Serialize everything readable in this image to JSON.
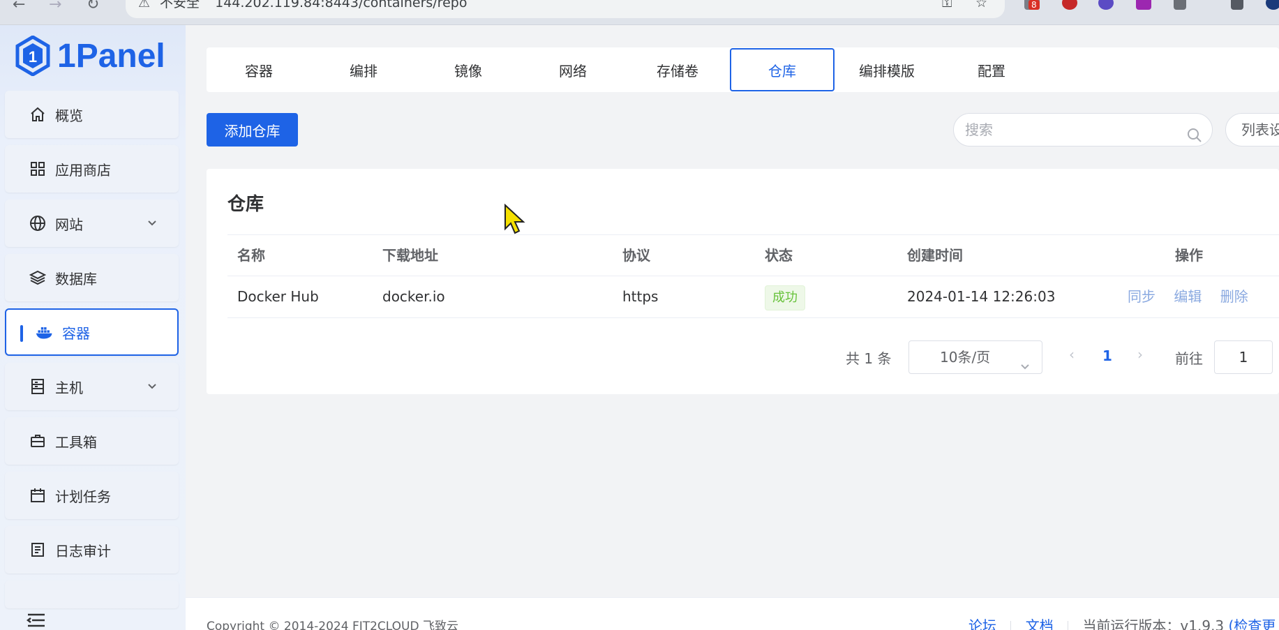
{
  "browser": {
    "security_label": "不安全",
    "url": "144.202.119.84:8443/containers/repo",
    "extension_badge": "8"
  },
  "sidebar": {
    "logo_text": "1Panel",
    "items": [
      {
        "label": "概览",
        "icon": "home-icon"
      },
      {
        "label": "应用商店",
        "icon": "grid-icon"
      },
      {
        "label": "网站",
        "icon": "globe-icon"
      },
      {
        "label": "数据库",
        "icon": "layers-icon"
      },
      {
        "label": "容器",
        "icon": "docker-icon"
      },
      {
        "label": "主机",
        "icon": "server-icon"
      },
      {
        "label": "工具箱",
        "icon": "toolbox-icon"
      },
      {
        "label": "计划任务",
        "icon": "calendar-icon"
      },
      {
        "label": "日志审计",
        "icon": "log-icon"
      }
    ]
  },
  "tabs": [
    {
      "label": "容器"
    },
    {
      "label": "编排"
    },
    {
      "label": "镜像"
    },
    {
      "label": "网络"
    },
    {
      "label": "存储卷"
    },
    {
      "label": "仓库",
      "active": true
    },
    {
      "label": "编排模版"
    },
    {
      "label": "配置"
    }
  ],
  "toolbar": {
    "add_label": "添加仓库",
    "search_placeholder": "搜索",
    "list_settings_label": "列表设"
  },
  "card": {
    "title": "仓库",
    "columns": [
      "名称",
      "下载地址",
      "协议",
      "状态",
      "创建时间",
      "操作"
    ],
    "rows": [
      {
        "name": "Docker Hub",
        "download_url": "docker.io",
        "protocol": "https",
        "status": "成功",
        "created": "2024-01-14 12:26:03",
        "actions": [
          "同步",
          "编辑",
          "删除"
        ]
      }
    ]
  },
  "pagination": {
    "total": "共 1 条",
    "page_size": "10条/页",
    "current_page": "1",
    "goto_label": "前往",
    "goto_value": "1"
  },
  "footer": {
    "copyright": "Copyright © 2014-2024 FIT2CLOUD 飞致云",
    "forum": "论坛",
    "docs": "文档",
    "version": "当前运行版本：v1.9.3",
    "check_update": "(检查更"
  },
  "colors": {
    "primary": "#1e63e6",
    "success": "#67c23a",
    "sidebar_bg": "#eaf0fb"
  }
}
